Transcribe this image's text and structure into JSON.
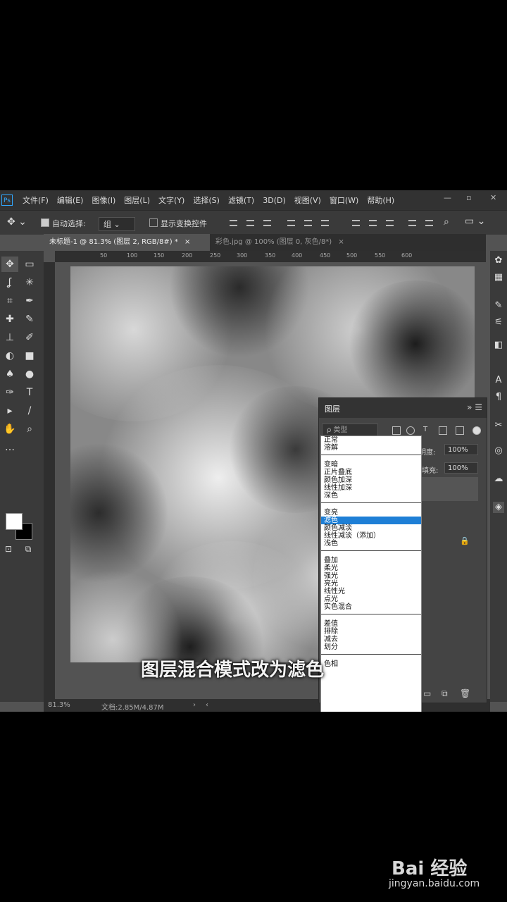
{
  "app": {
    "logo": "Ps"
  },
  "menu": [
    "文件(F)",
    "编辑(E)",
    "图像(I)",
    "图层(L)",
    "文字(Y)",
    "选择(S)",
    "滤镜(T)",
    "3D(D)",
    "视图(V)",
    "窗口(W)",
    "帮助(H)"
  ],
  "window_controls": {
    "minimize": "—",
    "restore": "▫",
    "close": "✕"
  },
  "options_bar": {
    "auto_select_label": "自动选择:",
    "auto_select_value": "组",
    "show_transform_label": "显示变换控件"
  },
  "tabs": [
    {
      "label": "未标题-1 @ 81.3% (图层 2, RGB/8#) *",
      "close": "×"
    },
    {
      "label": "彩色.jpg @ 100% (图层 0, 灰色/8*)",
      "close": "×"
    }
  ],
  "ruler_h": [
    "50",
    "100",
    "150",
    "200",
    "250",
    "300",
    "350",
    "400",
    "450",
    "500",
    "550",
    "600"
  ],
  "tools": [
    "✥",
    "▭",
    "ʆ",
    "✳",
    "⌗",
    "✒",
    "✚",
    "✎",
    "⊥",
    "✐",
    "◐",
    "■",
    "♠",
    "●",
    "✑",
    "T",
    "▸",
    "/",
    "✋",
    "⌕",
    "…"
  ],
  "layers_panel": {
    "title": "图层",
    "kind_filter": "ρ 类型",
    "blend_mode": "正常",
    "opacity_label": "不透明度:",
    "opacity_value": "100%",
    "fill_label": "填充:",
    "fill_value": "100%"
  },
  "blend_dropdown": {
    "groups": [
      [
        "正常",
        "溶解"
      ],
      [
        "变暗",
        "正片叠底",
        "颜色加深",
        "线性加深",
        "深色"
      ],
      [
        "变亮",
        "滤色",
        "颜色减淡",
        "线性减淡（添加）",
        "浅色"
      ],
      [
        "叠加",
        "柔光",
        "强光",
        "亮光",
        "线性光",
        "点光",
        "实色混合"
      ],
      [
        "差值",
        "排除",
        "减去",
        "划分"
      ],
      [
        "色相"
      ]
    ],
    "selected": "滤色"
  },
  "status": {
    "zoom": "81.3%",
    "doc": "文档:2.85M/4.87M"
  },
  "subtitle": "图层混合模式改为滤色",
  "watermark": {
    "logo": "Bai 经验",
    "url": "jingyan.baidu.com"
  },
  "colors": {
    "accent": "#1e7fd6",
    "ps_blue": "#31a8ff"
  }
}
